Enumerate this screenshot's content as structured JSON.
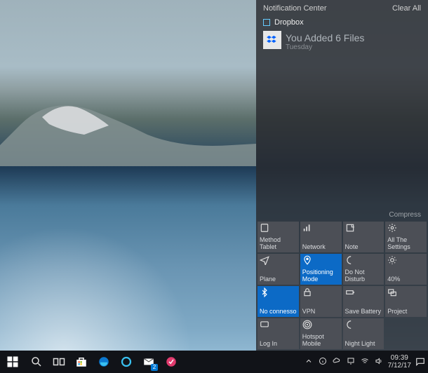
{
  "action_center": {
    "header_title": "Notification Center",
    "clear_all": "Clear All",
    "section": {
      "app": "Dropbox",
      "icon": "dropbox-icon"
    },
    "notification": {
      "title": "You Added 6 Files",
      "time": "Tuesday",
      "icon": "dropbox-icon"
    },
    "compress_label": "Compress",
    "tiles": [
      {
        "label": "Method Tablet",
        "icon": "tablet-icon",
        "active": false
      },
      {
        "label": "Network",
        "icon": "network-icon",
        "active": false
      },
      {
        "label": "Note",
        "icon": "note-icon",
        "active": false
      },
      {
        "label": "All The Settings",
        "icon": "gear-icon",
        "active": false
      },
      {
        "label": "Plane",
        "icon": "airplane-icon",
        "active": false
      },
      {
        "label": "Positioning Mode",
        "icon": "location-icon",
        "active": true
      },
      {
        "label": "Do Not Disturb",
        "icon": "moon-icon",
        "active": false
      },
      {
        "label": "40%",
        "icon": "brightness-icon",
        "active": false
      },
      {
        "label": "No connesso",
        "icon": "bluetooth-icon",
        "active": true
      },
      {
        "label": "VPN",
        "icon": "vpn-icon",
        "active": false
      },
      {
        "label": "Save Battery",
        "icon": "battery-icon",
        "active": false
      },
      {
        "label": "Project",
        "icon": "project-icon",
        "active": false
      },
      {
        "label": "Log In",
        "icon": "connect-icon",
        "active": false
      },
      {
        "label": "Hotspot Mobile",
        "icon": "hotspot-icon",
        "active": false
      },
      {
        "label": "Night Light",
        "icon": "nightlight-icon",
        "active": false
      }
    ]
  },
  "taskbar": {
    "start": "start-icon",
    "apps": [
      {
        "name": "search-icon"
      },
      {
        "name": "task-view-icon"
      },
      {
        "name": "store-icon"
      },
      {
        "name": "edge-icon"
      },
      {
        "name": "cortana-icon"
      },
      {
        "name": "mail-icon",
        "badge": "2"
      },
      {
        "name": "app-icon"
      }
    ],
    "tray": [
      {
        "name": "chevron-up-icon"
      },
      {
        "name": "info-icon"
      },
      {
        "name": "onedrive-icon"
      },
      {
        "name": "network-tray-icon"
      },
      {
        "name": "wifi-icon"
      },
      {
        "name": "volume-icon"
      }
    ],
    "time": "09:39",
    "date": "7/12/17",
    "notifications_icon": "notification-icon"
  }
}
